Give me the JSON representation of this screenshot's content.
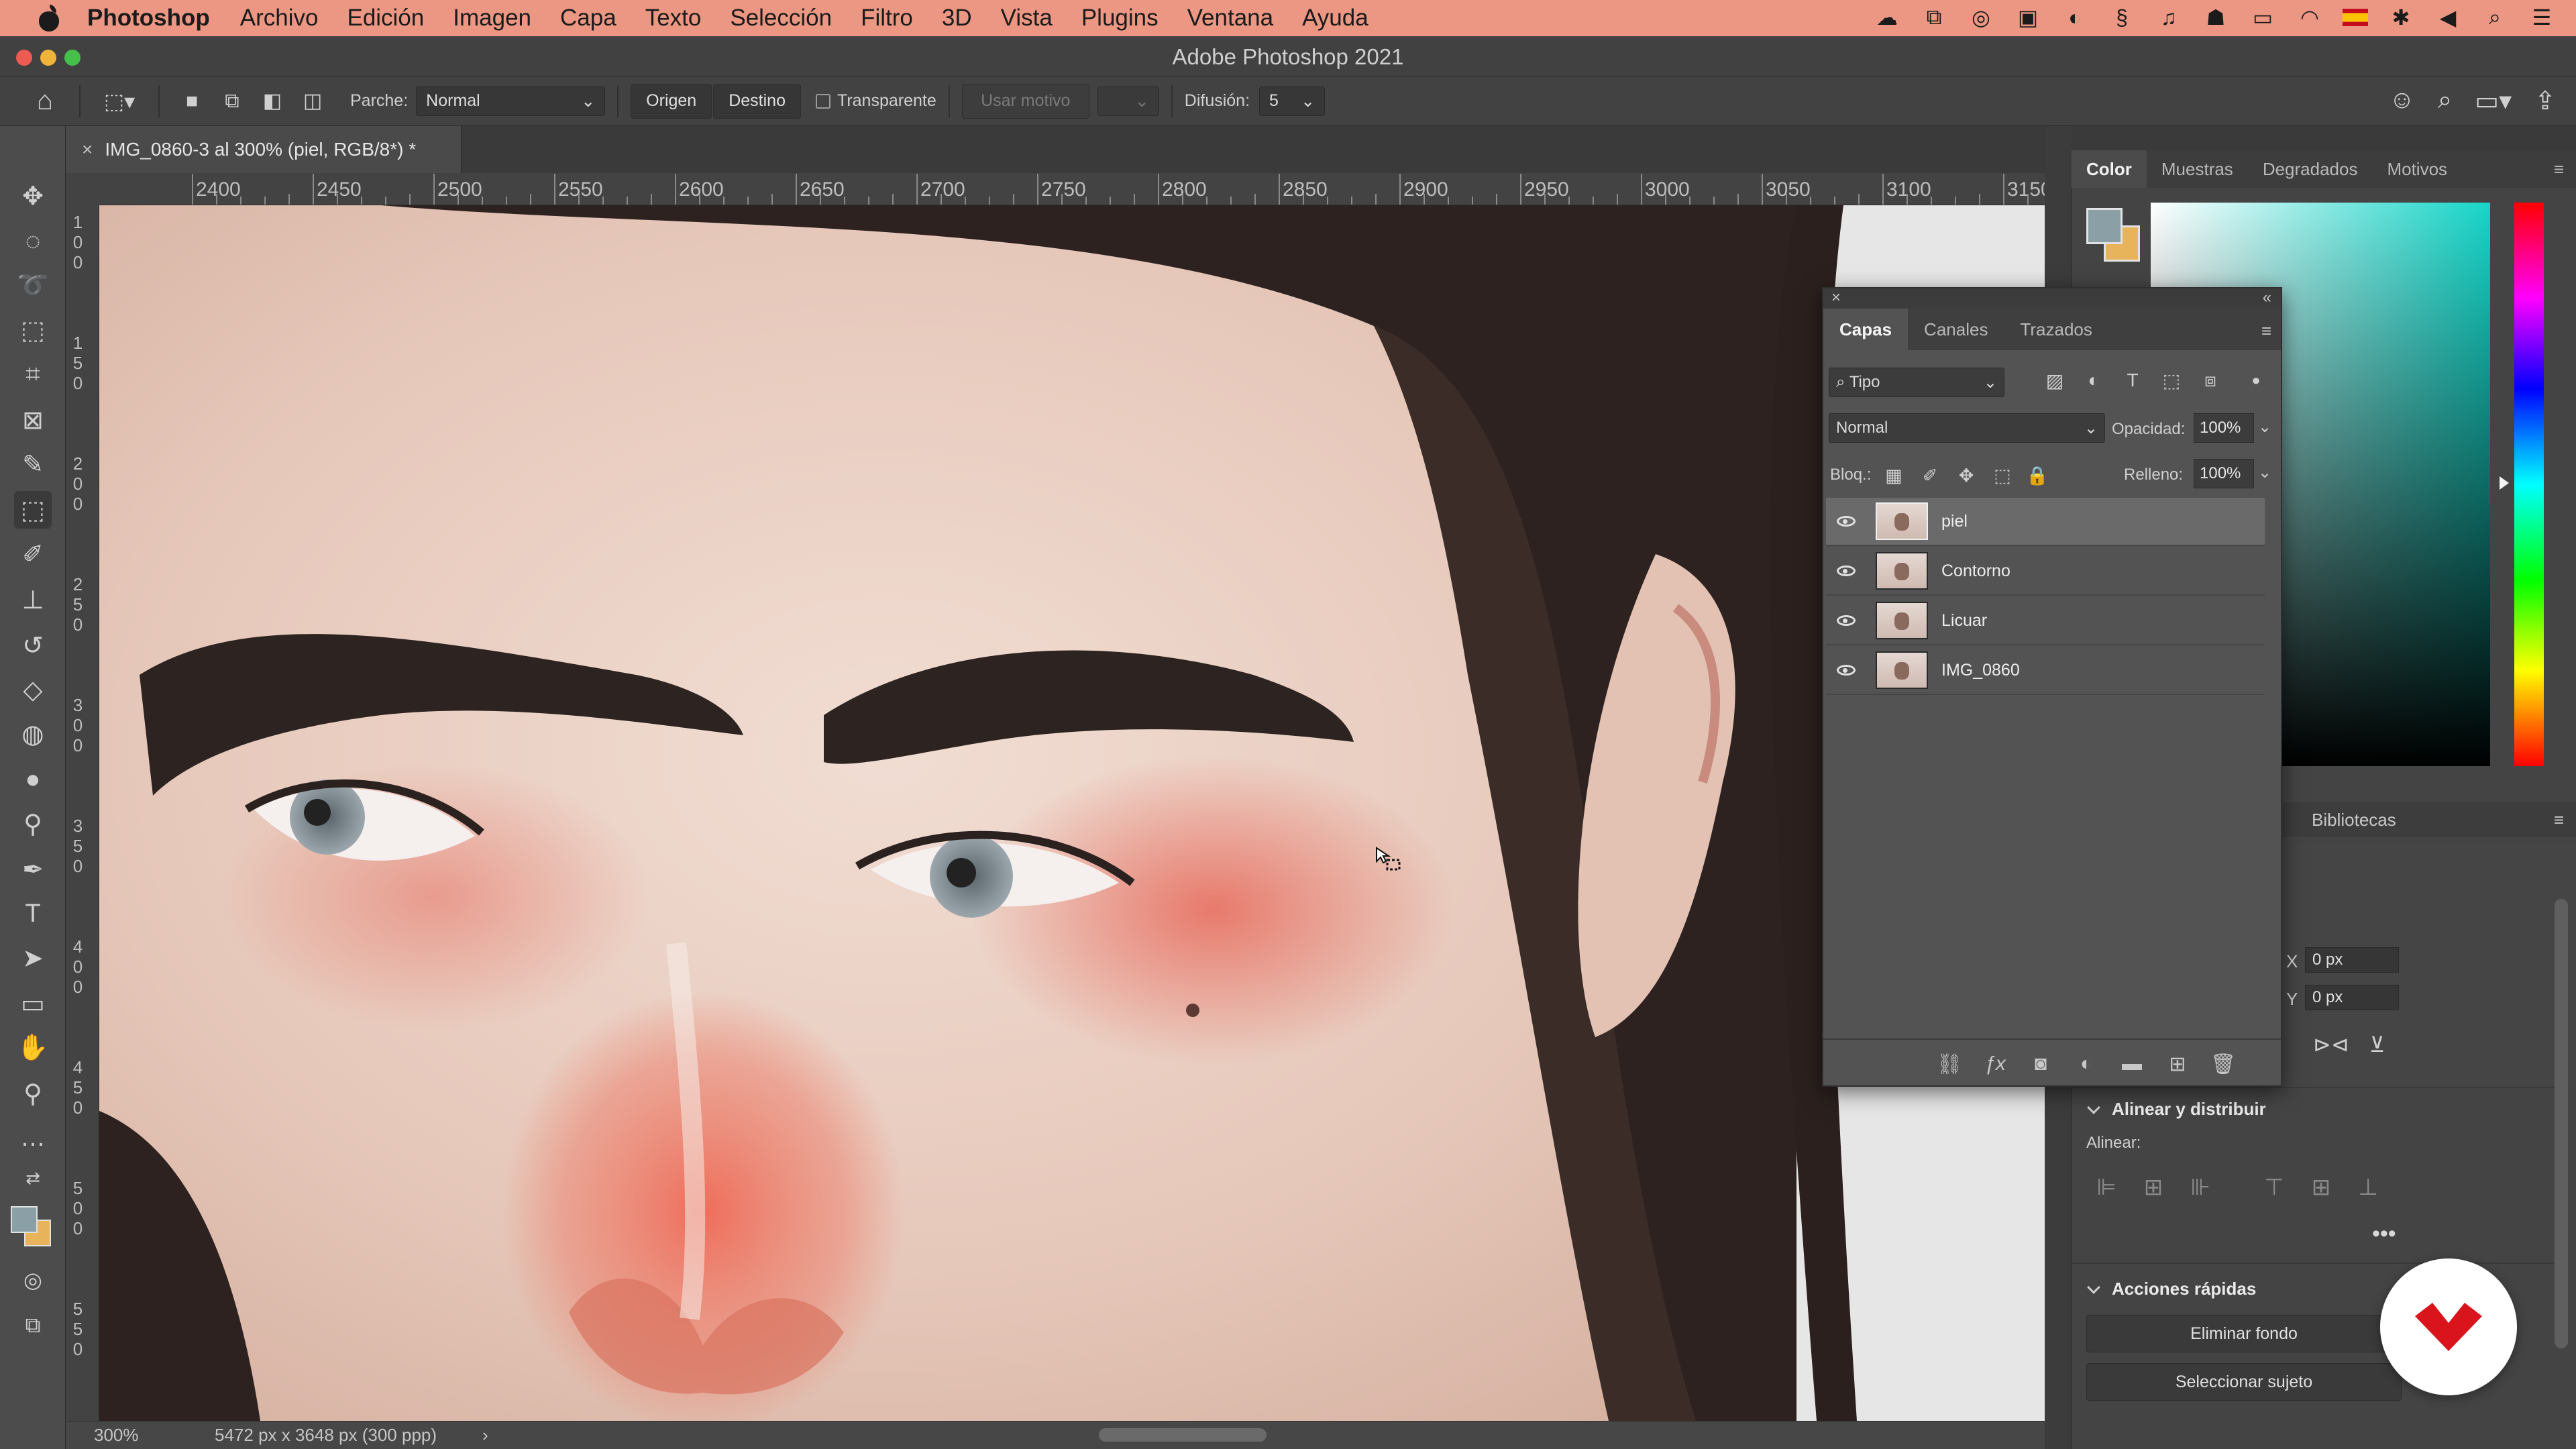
{
  "menubar": {
    "app_name": "Photoshop",
    "items": [
      "Archivo",
      "Edición",
      "Imagen",
      "Capa",
      "Texto",
      "Selección",
      "Filtro",
      "3D",
      "Vista",
      "Plugins",
      "Ventana",
      "Ayuda"
    ],
    "status_icons": [
      "creative-cloud-icon",
      "screen-share-icon",
      "speedtest-icon",
      "notion-icon",
      "toggle-icon",
      "s-app-icon",
      "music-icon",
      "robot-icon",
      "screen-icon",
      "wifi-icon",
      "spain-flag-icon",
      "bluetooth-icon",
      "volume-icon",
      "search-icon",
      "control-center-icon"
    ]
  },
  "window": {
    "title": "Adobe Photoshop 2021"
  },
  "options": {
    "patch_label": "Parche:",
    "patch_mode": "Normal",
    "origin_label": "Origen",
    "dest_label": "Destino",
    "transparent_label": "Transparente",
    "use_pattern_label": "Usar motivo",
    "diffusion_label": "Difusión:",
    "diffusion_value": "5"
  },
  "document": {
    "tab_title": "IMG_0860-3 al 300% (piel, RGB/8*) *",
    "zoom": "300%",
    "dimensions": "5472 px x 3648 px (300 ppp)"
  },
  "ruler": {
    "top_labels": [
      "2400",
      "2450",
      "2500",
      "2550",
      "2600",
      "2650",
      "2700",
      "2750",
      "2800",
      "2850",
      "2900",
      "2950",
      "3000",
      "3050",
      "3100",
      "3150"
    ],
    "left_labels": [
      "100",
      "150",
      "200",
      "250",
      "300",
      "350",
      "400",
      "450",
      "500",
      "550"
    ]
  },
  "color_panel": {
    "tabs": [
      "Color",
      "Muestras",
      "Degradados",
      "Motivos"
    ],
    "active_tab": "Color",
    "fg_color": "#8aa0a6",
    "bg_color": "#e7b45c"
  },
  "layers_panel": {
    "tabs": [
      "Capas",
      "Canales",
      "Trazados"
    ],
    "active_tab": "Capas",
    "filter_kind": "Tipo",
    "blend_mode": "Normal",
    "opacity_label": "Opacidad:",
    "opacity": "100%",
    "lock_label": "Bloq.:",
    "fill_label": "Relleno:",
    "fill": "100%",
    "layers": [
      {
        "name": "piel",
        "selected": true
      },
      {
        "name": "Contorno",
        "selected": false
      },
      {
        "name": "Licuar",
        "selected": false
      },
      {
        "name": "IMG_0860",
        "selected": false
      }
    ]
  },
  "libraries": {
    "label": "Bibliotecas"
  },
  "properties": {
    "x_label": "X",
    "x_value": "0 px",
    "y_label": "Y",
    "y_value": "0 px",
    "align_section": "Alinear y distribuir",
    "align_label": "Alinear:",
    "quick_actions": "Acciones rápidas",
    "remove_bg": "Eliminar fondo",
    "select_subject": "Seleccionar sujeto"
  },
  "colors": {
    "menubar": "#ec9783",
    "logo": "#d9141c"
  }
}
